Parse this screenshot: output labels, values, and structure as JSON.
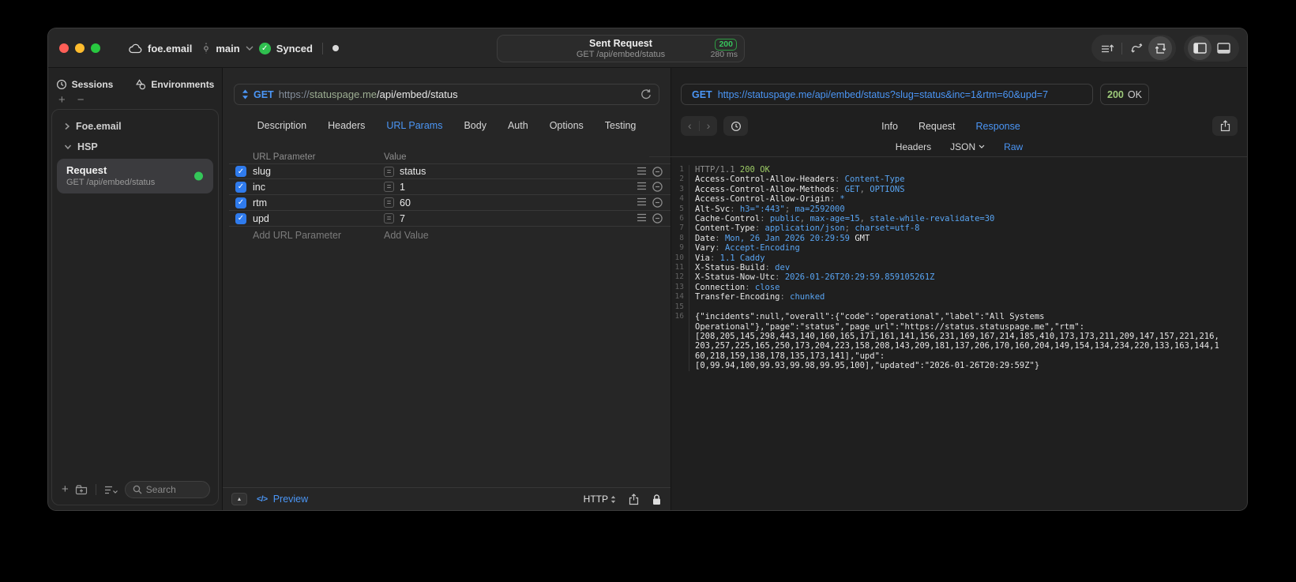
{
  "titlebar": {
    "project": "foe.email",
    "branch": "main",
    "sync_label": "Synced",
    "center": {
      "title": "Sent Request",
      "subtitle": "GET /api/embed/status",
      "status_code": "200",
      "duration": "280 ms"
    }
  },
  "sidebar": {
    "tabs": [
      {
        "label": "Sessions"
      },
      {
        "label": "Environments"
      }
    ],
    "tree": [
      {
        "label": "Foe.email"
      },
      {
        "label": "HSP"
      }
    ],
    "request_item": {
      "title": "Request",
      "subtitle": "GET /api/embed/status"
    },
    "search_placeholder": "Search"
  },
  "request_panel": {
    "method": "GET",
    "url": {
      "scheme": "https://",
      "host": "statuspage.me",
      "path": "/api/embed/status"
    },
    "tabs": [
      "Description",
      "Headers",
      "URL Params",
      "Body",
      "Auth",
      "Options",
      "Testing"
    ],
    "active_tab": "URL Params",
    "params": {
      "columns": [
        "URL Parameter",
        "Value"
      ],
      "rows": [
        {
          "name": "slug",
          "value": "status",
          "checked": true
        },
        {
          "name": "inc",
          "value": "1",
          "checked": true
        },
        {
          "name": "rtm",
          "value": "60",
          "checked": true
        },
        {
          "name": "upd",
          "value": "7",
          "checked": true
        }
      ],
      "add_param_placeholder": "Add URL Parameter",
      "add_value_placeholder": "Add Value"
    },
    "footer": {
      "preview_label": "Preview",
      "code_glyph": "</>",
      "protocol": "HTTP"
    }
  },
  "response_panel": {
    "method": "GET",
    "url": "https://statuspage.me/api/embed/status?slug=status&inc=1&rtm=60&upd=7",
    "status_code": "200",
    "status_text": "OK",
    "tabs": [
      "Info",
      "Request",
      "Response"
    ],
    "active_tab": "Response",
    "subtabs": [
      "Headers",
      "JSON",
      "Raw"
    ],
    "active_subtab": "Raw",
    "code": {
      "header_lines": [
        {
          "n": "1",
          "seg": [
            [
              "HTTP/1.1 ",
              "d"
            ],
            [
              "200 OK",
              "g"
            ]
          ]
        },
        {
          "n": "2",
          "seg": [
            [
              "Access-Control-Allow-Headers",
              "p"
            ],
            [
              ": ",
              "d"
            ],
            [
              "Content-Type",
              "b"
            ]
          ]
        },
        {
          "n": "3",
          "seg": [
            [
              "Access-Control-Allow-Methods",
              "p"
            ],
            [
              ": ",
              "d"
            ],
            [
              "GET",
              "b"
            ],
            [
              ", ",
              "d"
            ],
            [
              "OPTIONS",
              "b"
            ]
          ]
        },
        {
          "n": "4",
          "seg": [
            [
              "Access-Control-Allow-Origin",
              "p"
            ],
            [
              ": ",
              "d"
            ],
            [
              "*",
              "b"
            ]
          ]
        },
        {
          "n": "5",
          "seg": [
            [
              "Alt-Svc",
              "p"
            ],
            [
              ": ",
              "d"
            ],
            [
              "h3=\":443\"",
              "b"
            ],
            [
              "; ",
              "d"
            ],
            [
              "ma=2592000",
              "b"
            ]
          ]
        },
        {
          "n": "6",
          "seg": [
            [
              "Cache-Control",
              "p"
            ],
            [
              ": ",
              "d"
            ],
            [
              "public",
              "b"
            ],
            [
              ", ",
              "d"
            ],
            [
              "max-age=15",
              "b"
            ],
            [
              ", ",
              "d"
            ],
            [
              "stale-while-revalidate=30",
              "b"
            ]
          ]
        },
        {
          "n": "7",
          "seg": [
            [
              "Content-Type",
              "p"
            ],
            [
              ": ",
              "d"
            ],
            [
              "application/json",
              "b"
            ],
            [
              "; ",
              "d"
            ],
            [
              "charset=utf-8",
              "b"
            ]
          ]
        },
        {
          "n": "8",
          "seg": [
            [
              "Date",
              "p"
            ],
            [
              ": ",
              "d"
            ],
            [
              "Mon, 26 Jan 2026 20:29:59",
              "b"
            ],
            [
              " GMT",
              "p"
            ]
          ]
        },
        {
          "n": "9",
          "seg": [
            [
              "Vary",
              "p"
            ],
            [
              ": ",
              "d"
            ],
            [
              "Accept-Encoding",
              "b"
            ]
          ]
        },
        {
          "n": "10",
          "seg": [
            [
              "Via",
              "p"
            ],
            [
              ": ",
              "d"
            ],
            [
              "1.1 Caddy",
              "b"
            ]
          ]
        },
        {
          "n": "11",
          "seg": [
            [
              "X-Status-Build",
              "p"
            ],
            [
              ": ",
              "d"
            ],
            [
              "dev",
              "b"
            ]
          ]
        },
        {
          "n": "12",
          "seg": [
            [
              "X-Status-Now-Utc",
              "p"
            ],
            [
              ": ",
              "d"
            ],
            [
              "2026-01-26T20:29:59.859105261Z",
              "b"
            ]
          ]
        },
        {
          "n": "13",
          "seg": [
            [
              "Connection",
              "p"
            ],
            [
              ": ",
              "d"
            ],
            [
              "close",
              "b"
            ]
          ]
        },
        {
          "n": "14",
          "seg": [
            [
              "Transfer-Encoding",
              "p"
            ],
            [
              ": ",
              "d"
            ],
            [
              "chunked",
              "b"
            ]
          ]
        },
        {
          "n": "15",
          "seg": []
        }
      ],
      "body_line_number": "16",
      "body_rows": [
        "{\"incidents\":null,\"overall\":{\"code\":\"operational\",\"label\":\"All Systems",
        "Operational\"},\"page\":\"status\",\"page_url\":\"https://status.statuspage.me\",\"rtm\":",
        "[208,205,145,298,443,140,160,165,171,161,141,156,231,169,167,214,185,410,173,173,211,209,147,157,221,216,",
        "203,257,225,165,250,173,204,223,158,208,143,209,181,137,206,170,160,204,149,154,134,234,220,133,163,144,1",
        "60,218,159,138,178,135,173,141],\"upd\":",
        "[0,99.94,100,99.93,99.98,99.95,100],\"updated\":\"2026-01-26T20:29:59Z\"}"
      ]
    }
  },
  "colors": {
    "accent_blue": "#4b96f6",
    "success_green": "#34c759",
    "code_value_blue": "#58a4f2",
    "code_status_green": "#9ccb65",
    "window_bg": "#212121"
  }
}
